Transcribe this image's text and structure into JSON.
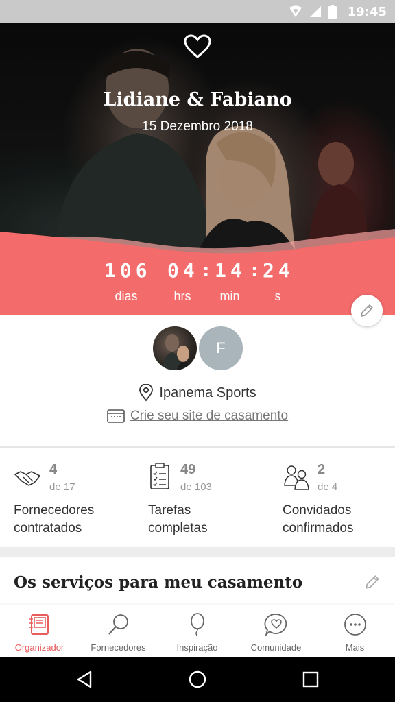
{
  "status_bar": {
    "time": "19:45"
  },
  "hero": {
    "names": "Lidiane & Fabiano",
    "date": "15 Dezembro 2018",
    "countdown": {
      "days": "106",
      "days_label": "dias",
      "hours": "04",
      "hours_label": "hrs",
      "minutes": "14",
      "minutes_label": "min",
      "seconds": "24",
      "seconds_label": "s"
    }
  },
  "profile": {
    "partner_initial": "F",
    "venue": "Ipanema Sports",
    "site_link": "Crie seu site de casamento"
  },
  "stats": [
    {
      "value": "4",
      "of": "de 17",
      "label_line1": "Fornecedores",
      "label_line2": "contratados",
      "icon": "handshake-icon"
    },
    {
      "value": "49",
      "of": "de 103",
      "label_line1": "Tarefas",
      "label_line2": "completas",
      "icon": "checklist-icon"
    },
    {
      "value": "2",
      "of": "de 4",
      "label_line1": "Convidados",
      "label_line2": "confirmados",
      "icon": "guests-icon"
    }
  ],
  "services": {
    "title": "Os serviços para meu casamento"
  },
  "bottom_nav": [
    {
      "label": "Organizador",
      "icon": "notebook-icon",
      "active": true
    },
    {
      "label": "Fornecedores",
      "icon": "magnifier-icon",
      "active": false
    },
    {
      "label": "Inspiração",
      "icon": "balloon-icon",
      "active": false
    },
    {
      "label": "Comunidade",
      "icon": "chat-heart-icon",
      "active": false
    },
    {
      "label": "Mais",
      "icon": "more-icon",
      "active": false
    }
  ],
  "colors": {
    "accent": "#f36b6b",
    "active_nav": "#e95c5c",
    "avatar_gray": "#a9b4bb"
  }
}
